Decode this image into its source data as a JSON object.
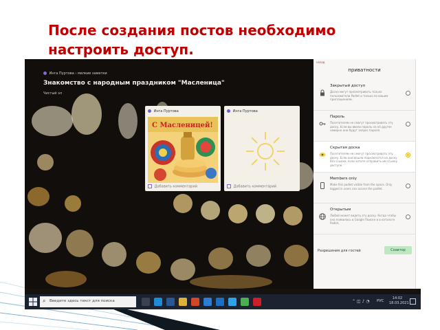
{
  "heading": {
    "line1": "После создания постов необходимо",
    "line2": "настроить доступ."
  },
  "padlet": {
    "breadcrumb_user": "Инга Пуртова",
    "breadcrumb_sep": "›",
    "breadcrumb_folder": "мелкие заметки",
    "title": "Знакомство с народным праздником \"Масленица\"",
    "subtitle": "Чистый эл",
    "posts": [
      {
        "author": "Инга Пуртова",
        "footer": "Добавить комментарий",
        "image": "maslenitsa-postcard"
      },
      {
        "author": "Инга Пуртова",
        "footer": "Добавить комментарий",
        "image": "sun-drawing"
      }
    ]
  },
  "privacy": {
    "top_hint": "назад",
    "title": "приватности",
    "options": [
      {
        "title": "Закрытый доступ",
        "desc": "Доска могут просматривать только пользователи Padlet и только по вашим приглашениям.",
        "icon": "lock-icon",
        "selected": false
      },
      {
        "title": "Пароль",
        "desc": "Посетителям не смогут просматривать эту доску. Если вы ввели пароль на её другое неверно они будут запрос пароля.",
        "icon": "key-icon",
        "selected": false
      },
      {
        "title": "Скрытая доска",
        "desc": "Посетителям не смогут просматривать эту доску. Если они вошли подключатся на доску без ссылки, если хотите отправить им ссылку доступе.",
        "icon": "eye-hidden-icon",
        "selected": true
      },
      {
        "title": "Members only",
        "desc": "Make this padlet visible from the space. Only logged in users can access the padlet.",
        "icon": "phone-icon",
        "selected": false
      },
      {
        "title": "Открытым",
        "desc": "Любой может видеть эту доску. Когда чтобы она появилась в Google Поиске и в каталоге Padlet.",
        "icon": "globe-icon",
        "selected": false
      }
    ],
    "permissions_label": "Разрешения для гостей",
    "permissions_value": "Соавтор"
  },
  "taskbar": {
    "search_placeholder": "Введите здесь текст для поиска",
    "lang": "РУС",
    "time": "14:02",
    "date": "18.03.2021",
    "apps": [
      {
        "name": "task-view",
        "color": "#3a4150"
      },
      {
        "name": "edge",
        "color": "#1f8ad6"
      },
      {
        "name": "word",
        "color": "#2b5797"
      },
      {
        "name": "explorer",
        "color": "#e0b13a"
      },
      {
        "name": "powerpoint",
        "color": "#d24726"
      },
      {
        "name": "store",
        "color": "#2d7dd2"
      },
      {
        "name": "mail",
        "color": "#1e6fc2"
      },
      {
        "name": "skype",
        "color": "#2ea3e8"
      },
      {
        "name": "chrome",
        "color": "#4caf50"
      },
      {
        "name": "opera",
        "color": "#cc1f2a"
      }
    ]
  }
}
